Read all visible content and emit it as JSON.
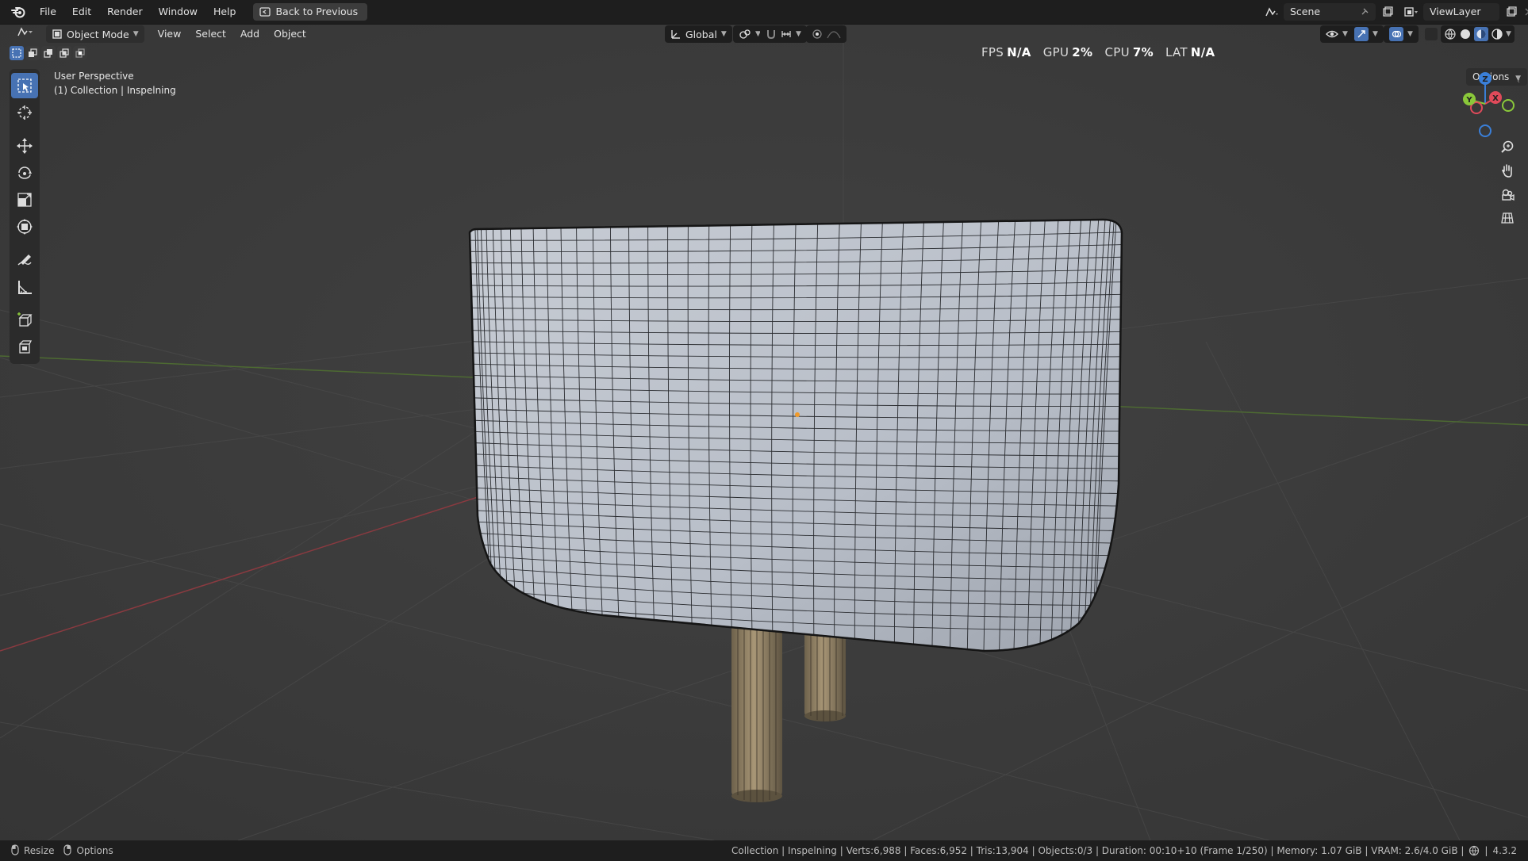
{
  "menu": {
    "file": "File",
    "edit": "Edit",
    "render": "Render",
    "window": "Window",
    "help": "Help",
    "back": "Back to Previous"
  },
  "scene": {
    "label": "Scene",
    "viewlayer": "ViewLayer"
  },
  "header": {
    "mode": "Object Mode",
    "view": "View",
    "select": "Select",
    "add": "Add",
    "object": "Object",
    "orientation": "Global",
    "options": "Options"
  },
  "perf": {
    "fps_label": "FPS",
    "fps": "N/A",
    "gpu_label": "GPU",
    "gpu": "2%",
    "cpu_label": "CPU",
    "cpu": "7%",
    "lat_label": "LAT",
    "lat": "N/A"
  },
  "viewport": {
    "perspective": "User Perspective",
    "collection": "(1) Collection | Inspelning"
  },
  "gizmo": {
    "x": "X",
    "y": "Y",
    "z": "Z"
  },
  "status": {
    "resize": "Resize",
    "options": "Options",
    "info": "Collection | Inspelning | Verts:6,988 | Faces:6,952 | Tris:13,904 | Objects:0/3 | Duration: 00:10+10 (Frame 1/250) | Memory: 1.07 GiB | VRAM: 2.6/4.0 GiB |",
    "version": "4.3.2"
  },
  "colors": {
    "accent": "#4772b3",
    "axis_x": "#e04a5a",
    "axis_y": "#8ac83a",
    "axis_z": "#3a7fd8",
    "mesh": "#bcc2cc",
    "prongs": "#9c8a6a"
  }
}
